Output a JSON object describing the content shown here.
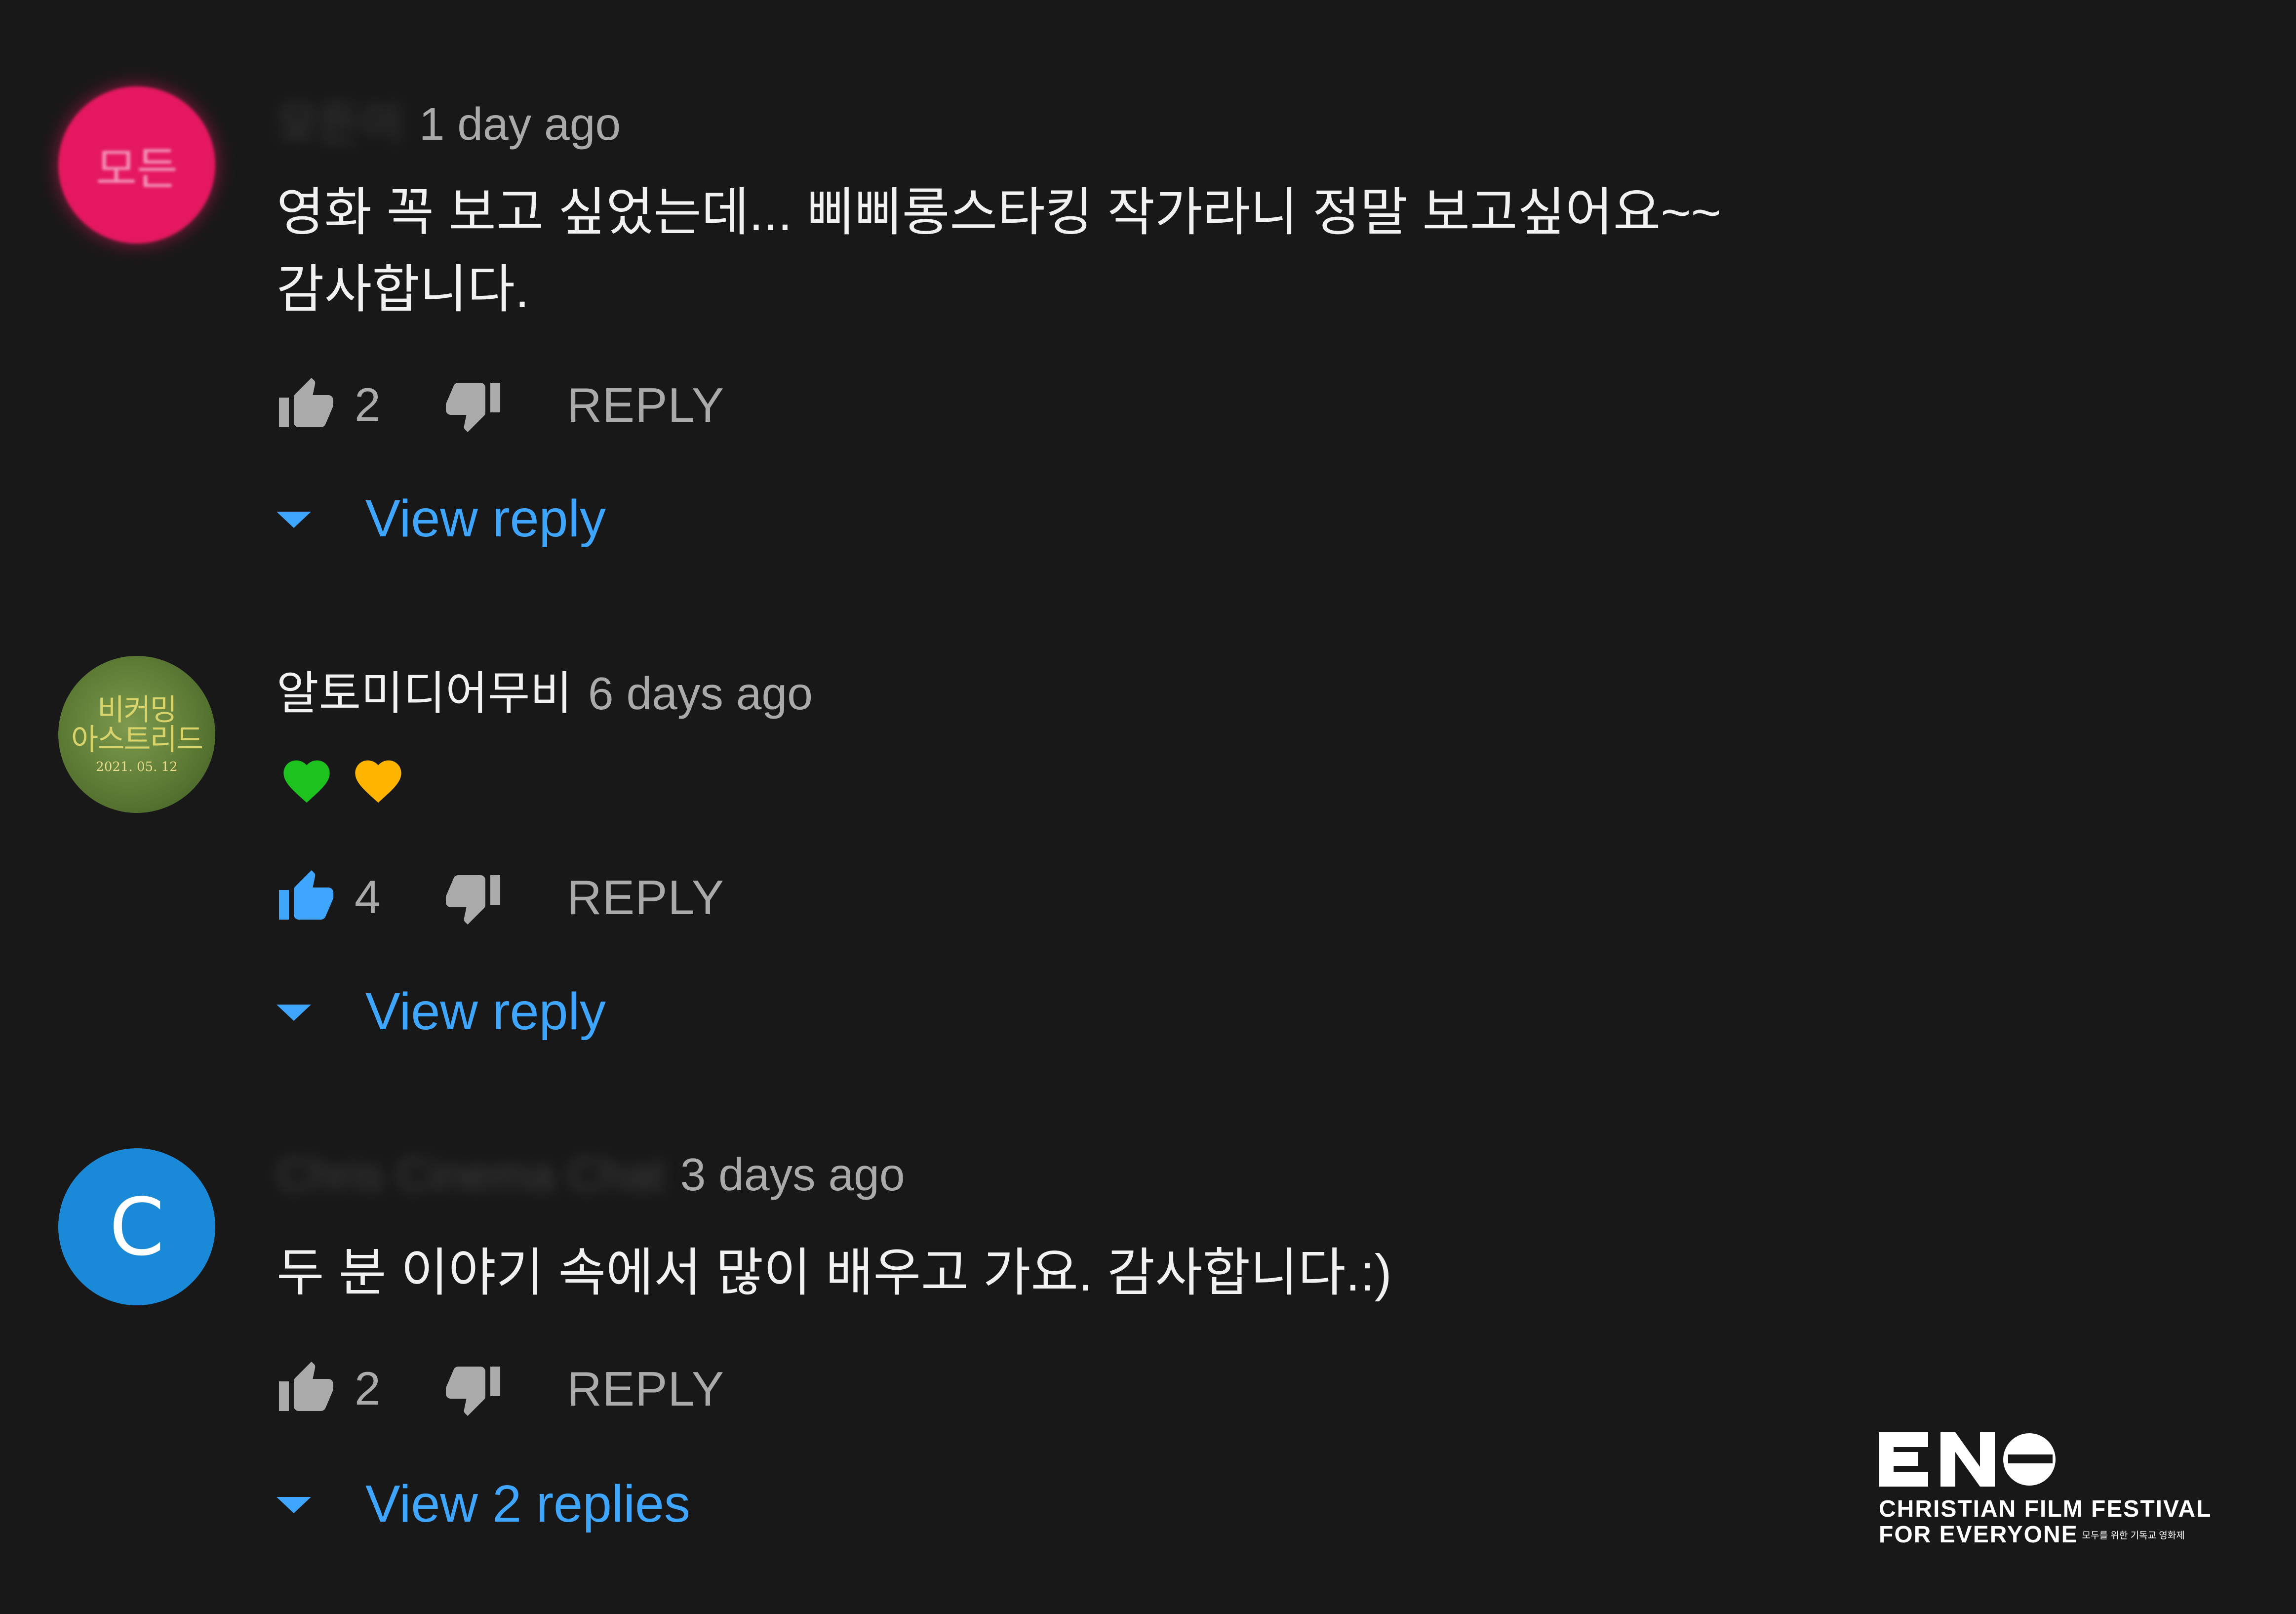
{
  "comments": [
    {
      "author": "모든이",
      "time": "1 day ago",
      "avatar": {
        "text": "모든",
        "color": "#e5185f"
      },
      "lines": [
        "영화 꼭 보고 싶었는데... 삐삐롱스타킹 작가라니 정말 보고싶어요~~",
        "감사합니다."
      ],
      "likes": "2",
      "liked": false,
      "reply_label": "REPLY",
      "view_replies_label": "View reply"
    },
    {
      "author": "알토미디어무비",
      "time": "6 days ago",
      "avatar": {
        "line1": "비커밍",
        "line2": "아스트리드",
        "date": "2021. 05. 12",
        "color": "#5f7d3c"
      },
      "lines": [
        "💚 💛"
      ],
      "likes": "4",
      "liked": true,
      "reply_label": "REPLY",
      "view_replies_label": "View reply"
    },
    {
      "author": "Chris Cinema Chat",
      "time": "3 days ago",
      "avatar": {
        "letter": "C",
        "color": "#1a8ad8"
      },
      "lines": [
        "두 분 이야기 속에서 많이 배우고 가요. 감사합니다.:)"
      ],
      "likes": "2",
      "liked": false,
      "reply_label": "REPLY",
      "view_replies_label": "View 2 replies"
    }
  ],
  "logo": {
    "line1": "CHRISTIAN FILM FESTIVAL",
    "line2": "FOR EVERYONE",
    "tagline": "모두를 위한 기독교 영화제"
  },
  "colors": {
    "link": "#3ea6ff",
    "like_active": "#3ea6ff",
    "muted": "#aaaaaa"
  }
}
